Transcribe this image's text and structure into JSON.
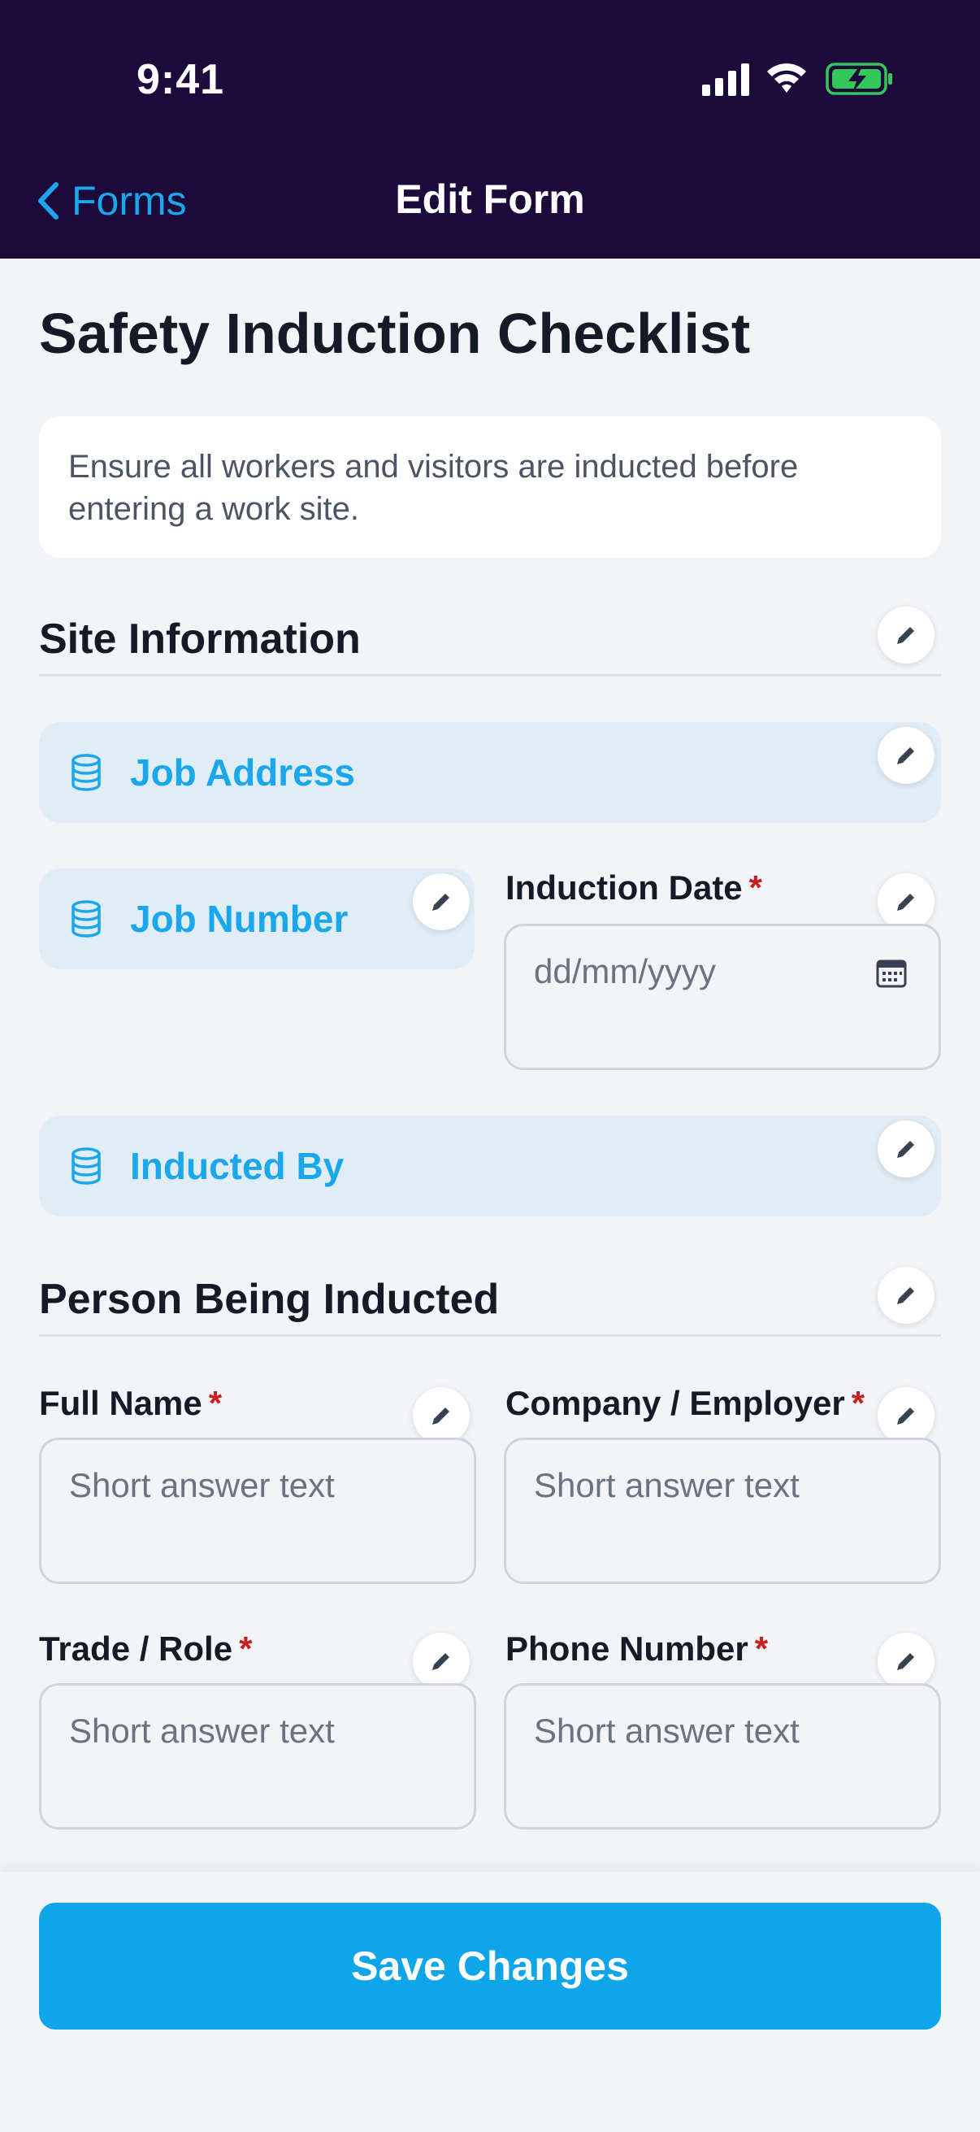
{
  "status_bar": {
    "time": "9:41",
    "icons": [
      "cellular-signal-icon",
      "wifi-icon",
      "battery-charging-icon"
    ]
  },
  "nav": {
    "back_label": "Forms",
    "title": "Edit Form"
  },
  "form": {
    "title": "Safety Induction Checklist",
    "description": "Ensure all workers and visitors are inducted before entering a work site."
  },
  "sections": [
    {
      "title": "Site Information",
      "fields": [
        {
          "type": "database",
          "label": "Job Address"
        },
        {
          "type": "database",
          "label": "Job Number"
        },
        {
          "type": "date",
          "label": "Induction Date",
          "required": true,
          "placeholder": "dd/mm/yyyy"
        },
        {
          "type": "database",
          "label": "Inducted By"
        }
      ]
    },
    {
      "title": "Person Being Inducted",
      "fields": [
        {
          "type": "short_text",
          "label": "Full Name",
          "required": true,
          "placeholder": "Short answer text"
        },
        {
          "type": "short_text",
          "label": "Company / Employer",
          "required": true,
          "placeholder": "Short answer text"
        },
        {
          "type": "short_text",
          "label": "Trade / Role",
          "required": true,
          "placeholder": "Short answer text"
        },
        {
          "type": "short_text",
          "label": "Phone Number",
          "required": true,
          "placeholder": "Short answer text"
        }
      ]
    }
  ],
  "required_marker": "*",
  "footer": {
    "save_label": "Save Changes"
  },
  "colors": {
    "header_bg": "#1c0a3b",
    "accent": "#0fa5e9",
    "link": "#1aa7ec",
    "required": "#c81e1e",
    "db_field_bg": "#e0edf6",
    "page_bg": "#f2f4f7"
  }
}
